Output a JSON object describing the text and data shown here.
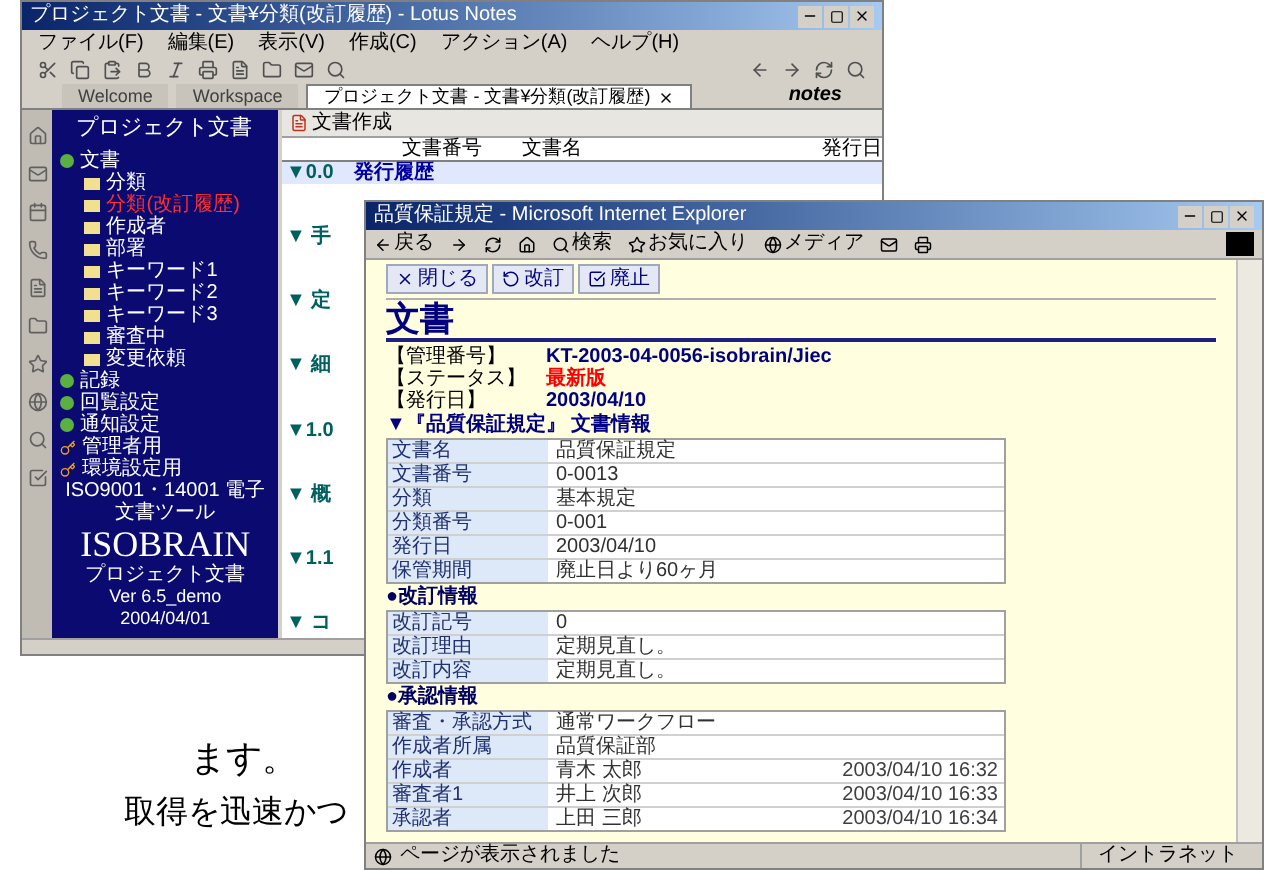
{
  "notes_window": {
    "title": "プロジェクト文書 - 文書¥分類(改訂履歴) - Lotus Notes",
    "menu": [
      "ファイル(F)",
      "編集(E)",
      "表示(V)",
      "作成(C)",
      "アクション(A)",
      "ヘルプ(H)"
    ],
    "tabs": [
      {
        "label": "Welcome",
        "selected": false,
        "closable": false
      },
      {
        "label": "Workspace",
        "selected": false,
        "closable": false
      },
      {
        "label": "プロジェクト文書 - 文書¥分類(改訂履歴)",
        "selected": true,
        "closable": true
      }
    ],
    "brand": "notes",
    "navigator": {
      "title": "プロジェクト文書",
      "items": [
        {
          "label": "文書",
          "kind": "view",
          "selected": false,
          "children": [
            {
              "label": "分類",
              "kind": "folder",
              "selected": false
            },
            {
              "label": "分類(改訂履歴)",
              "kind": "folder",
              "selected": true
            },
            {
              "label": "作成者",
              "kind": "folder",
              "selected": false
            },
            {
              "label": "部署",
              "kind": "folder",
              "selected": false
            },
            {
              "label": "キーワード1",
              "kind": "folder",
              "selected": false
            },
            {
              "label": "キーワード2",
              "kind": "folder",
              "selected": false
            },
            {
              "label": "キーワード3",
              "kind": "folder",
              "selected": false
            },
            {
              "label": "審査中",
              "kind": "folder",
              "selected": false
            },
            {
              "label": "変更依頼",
              "kind": "folder",
              "selected": false
            }
          ]
        },
        {
          "label": "記録",
          "kind": "view",
          "selected": false
        },
        {
          "label": "回覧設定",
          "kind": "view",
          "selected": false
        },
        {
          "label": "通知設定",
          "kind": "view",
          "selected": false
        },
        {
          "label": "管理者用",
          "kind": "key",
          "selected": false
        },
        {
          "label": "環境設定用",
          "kind": "key",
          "selected": false
        }
      ],
      "footer": {
        "tagline": "ISO9001・14001 電子文書ツール",
        "logo": "ISOBRAIN",
        "product": "プロジェクト文書",
        "version": "Ver 6.5_demo",
        "date": "2004/04/01"
      }
    },
    "view": {
      "action": "文書作成",
      "columns": [
        "文書番号",
        "文書名",
        "発行日"
      ],
      "rows": [
        {
          "cells": [
            "▼0.0",
            "発行履歴"
          ]
        },
        {
          "cells": [
            "▼ 手"
          ]
        },
        {
          "cells": [
            "▼ 定"
          ]
        },
        {
          "cells": [
            "▼ 細"
          ]
        },
        {
          "cells": [
            "▼1.0"
          ]
        },
        {
          "cells": [
            "▼ 概"
          ]
        },
        {
          "cells": [
            "▼1.1"
          ]
        },
        {
          "cells": [
            "▼ コ"
          ]
        }
      ]
    }
  },
  "ie_window": {
    "title": "品質保証規定 - Microsoft Internet Explorer",
    "toolbar": [
      "戻る",
      "検索",
      "お気に入り",
      "メディア"
    ],
    "actions": [
      "閉じる",
      "改訂",
      "廃止"
    ],
    "heading": "文書",
    "meta": [
      {
        "label": "【管理番号】",
        "value": "KT-2003-04-0056-isobrain/Jiec",
        "kind": "plain"
      },
      {
        "label": "【ステータス】",
        "value": "最新版",
        "kind": "alert"
      },
      {
        "label": "【発行日】",
        "value": "2003/04/10",
        "kind": "plain"
      }
    ],
    "sections": [
      {
        "title": "▼『品質保証規定』 文書情報",
        "kind": "main",
        "rows": [
          {
            "label": "文書名",
            "value": "品質保証規定"
          },
          {
            "label": "文書番号",
            "value": "0-0013"
          },
          {
            "label": "分類",
            "value": "基本規定"
          },
          {
            "label": "分類番号",
            "value": "0-001"
          },
          {
            "label": "発行日",
            "value": "2003/04/10"
          },
          {
            "label": "保管期間",
            "value": "廃止日より60ヶ月"
          }
        ]
      },
      {
        "title": "●改訂情報",
        "kind": "sub",
        "rows": [
          {
            "label": "改訂記号",
            "value": "0"
          },
          {
            "label": "改訂理由",
            "value": "定期見直し。"
          },
          {
            "label": "改訂内容",
            "value": "定期見直し。"
          }
        ]
      },
      {
        "title": "●承認情報",
        "kind": "sub",
        "rows": [
          {
            "label": "審査・承認方式",
            "value": "通常ワークフロー"
          },
          {
            "label": "作成者所属",
            "value": "品質保証部"
          },
          {
            "label": "作成者",
            "value": "青木 太郎",
            "date": "2003/04/10 16:32"
          },
          {
            "label": "審査者1",
            "value": "井上 次郎",
            "date": "2003/04/10 16:33"
          },
          {
            "label": "承認者",
            "value": "上田 三郎",
            "date": "2003/04/10 16:34"
          }
        ]
      }
    ],
    "status": "ページが表示されました",
    "zone": "イントラネット"
  },
  "caption_fragments": [
    "ます。",
    "取得を迅速かつ"
  ]
}
